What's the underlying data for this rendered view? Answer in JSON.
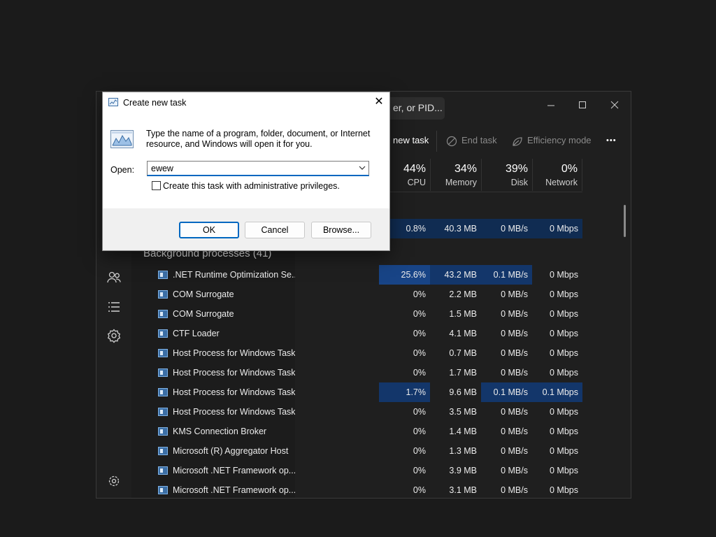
{
  "taskmanager": {
    "search_text": "er, or PID...",
    "toolbar": {
      "run_new_task": "new task",
      "end_task": "End task",
      "efficiency_mode": "Efficiency mode",
      "more": "•••"
    },
    "columns": [
      {
        "percent": "44%",
        "label": "CPU"
      },
      {
        "percent": "34%",
        "label": "Memory"
      },
      {
        "percent": "39%",
        "label": "Disk"
      },
      {
        "percent": "0%",
        "label": "Network"
      }
    ],
    "top_row": {
      "cpu": "0.8%",
      "memory": "40.3 MB",
      "disk": "0 MB/s",
      "network": "0 Mbps"
    },
    "group_label": "Background processes (41)",
    "processes": [
      {
        "name": ".NET Runtime Optimization Se...",
        "cpu": "25.6%",
        "memory": "43.2 MB",
        "disk": "0.1 MB/s",
        "network": "0 Mbps"
      },
      {
        "name": "COM Surrogate",
        "cpu": "0%",
        "memory": "2.2 MB",
        "disk": "0 MB/s",
        "network": "0 Mbps"
      },
      {
        "name": "COM Surrogate",
        "cpu": "0%",
        "memory": "1.5 MB",
        "disk": "0 MB/s",
        "network": "0 Mbps"
      },
      {
        "name": "CTF Loader",
        "cpu": "0%",
        "memory": "4.1 MB",
        "disk": "0 MB/s",
        "network": "0 Mbps"
      },
      {
        "name": "Host Process for Windows Tasks",
        "cpu": "0%",
        "memory": "0.7 MB",
        "disk": "0 MB/s",
        "network": "0 Mbps"
      },
      {
        "name": "Host Process for Windows Tasks",
        "cpu": "0%",
        "memory": "1.7 MB",
        "disk": "0 MB/s",
        "network": "0 Mbps"
      },
      {
        "name": "Host Process for Windows Tasks",
        "cpu": "1.7%",
        "memory": "9.6 MB",
        "disk": "0.1 MB/s",
        "network": "0.1 Mbps"
      },
      {
        "name": "Host Process for Windows Tasks",
        "cpu": "0%",
        "memory": "3.5 MB",
        "disk": "0 MB/s",
        "network": "0 Mbps"
      },
      {
        "name": "KMS Connection Broker",
        "cpu": "0%",
        "memory": "1.4 MB",
        "disk": "0 MB/s",
        "network": "0 Mbps"
      },
      {
        "name": "Microsoft (R) Aggregator Host",
        "cpu": "0%",
        "memory": "1.3 MB",
        "disk": "0 MB/s",
        "network": "0 Mbps"
      },
      {
        "name": "Microsoft .NET Framework op...",
        "cpu": "0%",
        "memory": "3.9 MB",
        "disk": "0 MB/s",
        "network": "0 Mbps"
      },
      {
        "name": "Microsoft .NET Framework op...",
        "cpu": "0%",
        "memory": "3.1 MB",
        "disk": "0 MB/s",
        "network": "0 Mbps"
      }
    ],
    "nav_icons": [
      "users-icon",
      "details-list-icon",
      "services-icon",
      "settings-icon"
    ]
  },
  "dialog": {
    "title": "Create new task",
    "description": "Type the name of a program, folder, document, or Internet resource, and Windows will open it for you.",
    "open_label": "Open:",
    "open_value": "ewew",
    "admin_checkbox_label": "Create this task with administrative privileges.",
    "admin_checked": false,
    "ok_label": "OK",
    "cancel_label": "Cancel",
    "browse_label": "Browse...",
    "close_glyph": "✕"
  },
  "colors": {
    "background": "#1b1b1b",
    "heat_high": "#184486",
    "heat_med": "#13366a",
    "heat_low": "#102c52",
    "accent": "#0067c0"
  }
}
